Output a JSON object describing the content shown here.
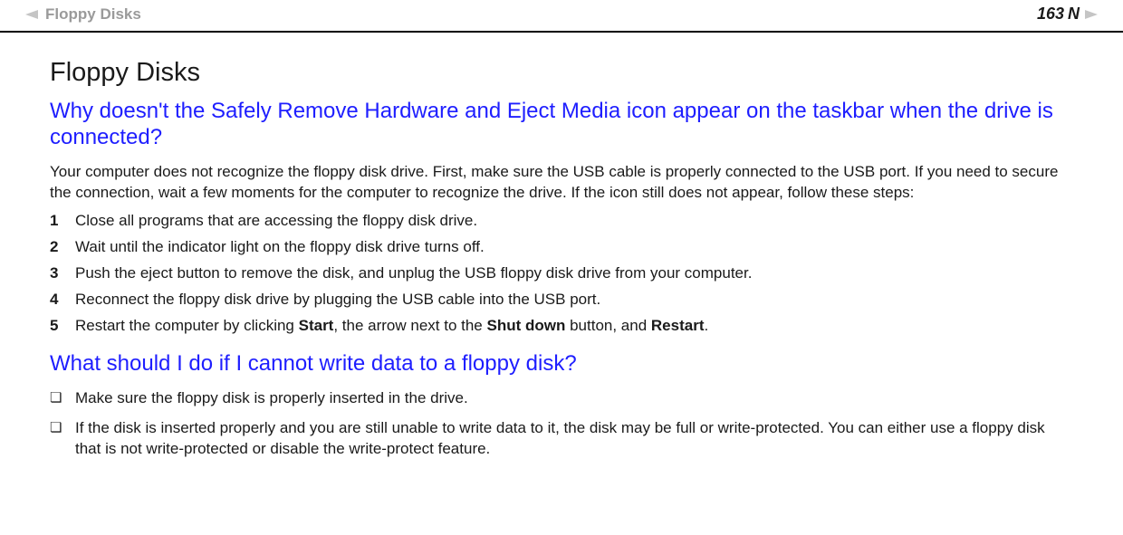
{
  "header": {
    "breadcrumb": "Floppy Disks",
    "page_number": "163",
    "n_label": "N"
  },
  "content": {
    "title": "Floppy Disks",
    "q1": "Why doesn't the Safely Remove Hardware and Eject Media icon appear on the taskbar when the drive is connected?",
    "intro": "Your computer does not recognize the floppy disk drive. First, make sure the USB cable is properly connected to the USB port. If you need to secure the connection, wait a few moments for the computer to recognize the drive. If the icon still does not appear, follow these steps:",
    "steps": [
      "Close all programs that are accessing the floppy disk drive.",
      "Wait until the indicator light on the floppy disk drive turns off.",
      "Push the eject button to remove the disk, and unplug the USB floppy disk drive from your computer.",
      "Reconnect the floppy disk drive by plugging the USB cable into the USB port."
    ],
    "step5_prefix": "Restart the computer by clicking ",
    "step5_b1": "Start",
    "step5_mid1": ", the arrow next to the ",
    "step5_b2": "Shut down",
    "step5_mid2": " button, and ",
    "step5_b3": "Restart",
    "step5_end": ".",
    "q2": "What should I do if I cannot write data to a floppy disk?",
    "bullets": [
      "Make sure the floppy disk is properly inserted in the drive.",
      "If the disk is inserted properly and you are still unable to write data to it, the disk may be full or write-protected. You can either use a floppy disk that is not write-protected or disable the write-protect feature."
    ],
    "step_nums": [
      "1",
      "2",
      "3",
      "4",
      "5"
    ],
    "square": "❏"
  }
}
